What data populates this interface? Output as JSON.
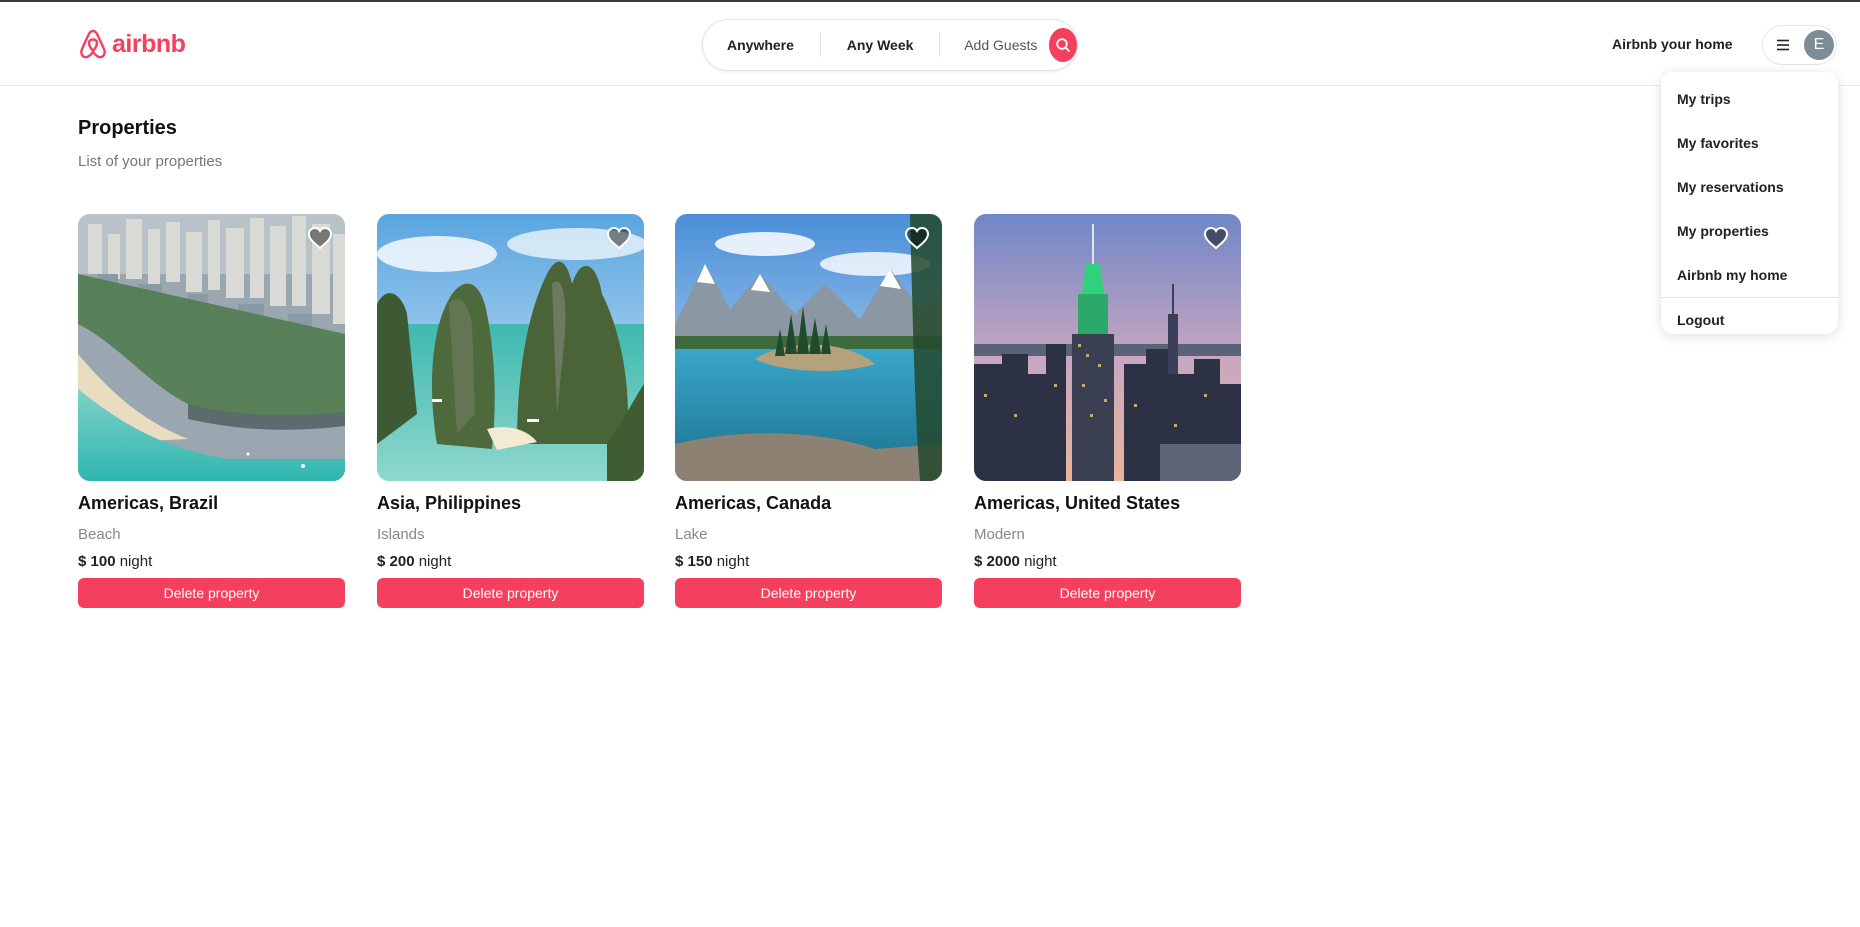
{
  "brand": {
    "name": "airbnb",
    "color": "#f43f5e"
  },
  "search": {
    "location": "Anywhere",
    "week": "Any Week",
    "guests": "Add Guests"
  },
  "header": {
    "host_link": "Airbnb your home",
    "avatar_initial": "E"
  },
  "user_menu": {
    "items": [
      {
        "label": "My trips"
      },
      {
        "label": "My favorites"
      },
      {
        "label": "My reservations"
      },
      {
        "label": "My properties"
      },
      {
        "label": "Airbnb my home"
      }
    ],
    "logout": "Logout"
  },
  "page": {
    "title": "Properties",
    "subtitle": "List of your properties"
  },
  "listings": [
    {
      "location": "Americas, Brazil",
      "category": "Beach",
      "price": "$ 100",
      "unit": "night",
      "action": "Delete property"
    },
    {
      "location": "Asia, Philippines",
      "category": "Islands",
      "price": "$ 200",
      "unit": "night",
      "action": "Delete property"
    },
    {
      "location": "Americas, Canada",
      "category": "Lake",
      "price": "$ 150",
      "unit": "night",
      "action": "Delete property"
    },
    {
      "location": "Americas, United States",
      "category": "Modern",
      "price": "$ 2000",
      "unit": "night",
      "action": "Delete property"
    }
  ]
}
